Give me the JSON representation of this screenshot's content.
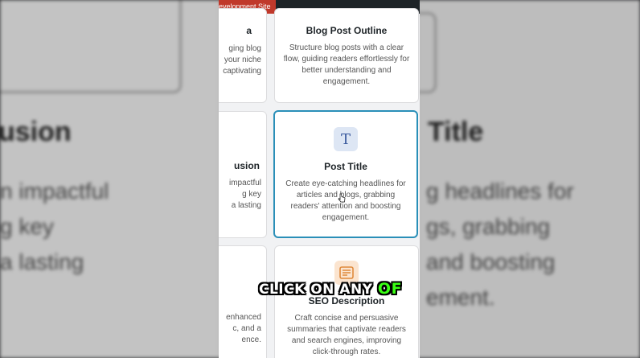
{
  "admin_bar": {
    "dev_badge": "evelopment Site"
  },
  "background": {
    "left_title": "usion",
    "left_lines": [
      "n impactful",
      "g key",
      "a lasting"
    ],
    "right_title": "Title",
    "right_lines": [
      "g headlines for",
      "gs, grabbing",
      "and boosting",
      "ement."
    ]
  },
  "cards": {
    "top_left": {
      "title": "a",
      "lines": [
        "ging blog",
        "your niche",
        "captivating"
      ]
    },
    "blog_post_outline": {
      "title": "Blog Post Outline",
      "description": "Structure blog posts with a clear flow, guiding readers effortlessly for better understanding and engagement."
    },
    "mid_left": {
      "title": "usion",
      "lines": [
        "impactful",
        "g key",
        "a lasting"
      ]
    },
    "post_title": {
      "title": "Post Title",
      "description": "Create eye-catching headlines for articles and blogs, grabbing readers' attention and boosting engagement.",
      "icon": "text-icon"
    },
    "bottom_left": {
      "lines": [
        "enhanced",
        "c, and a",
        "ence."
      ]
    },
    "seo_description": {
      "title": "SEO Description",
      "description": "Craft concise and persuasive summaries that captivate readers and search engines, improving click-through rates.",
      "icon": "document-icon"
    }
  },
  "caption": {
    "text": "CLICK ON ANY",
    "highlight": "OF"
  },
  "colors": {
    "accent": "#2a8fb8",
    "badge": "#c0392b",
    "caption_highlight": "#39ff14"
  }
}
